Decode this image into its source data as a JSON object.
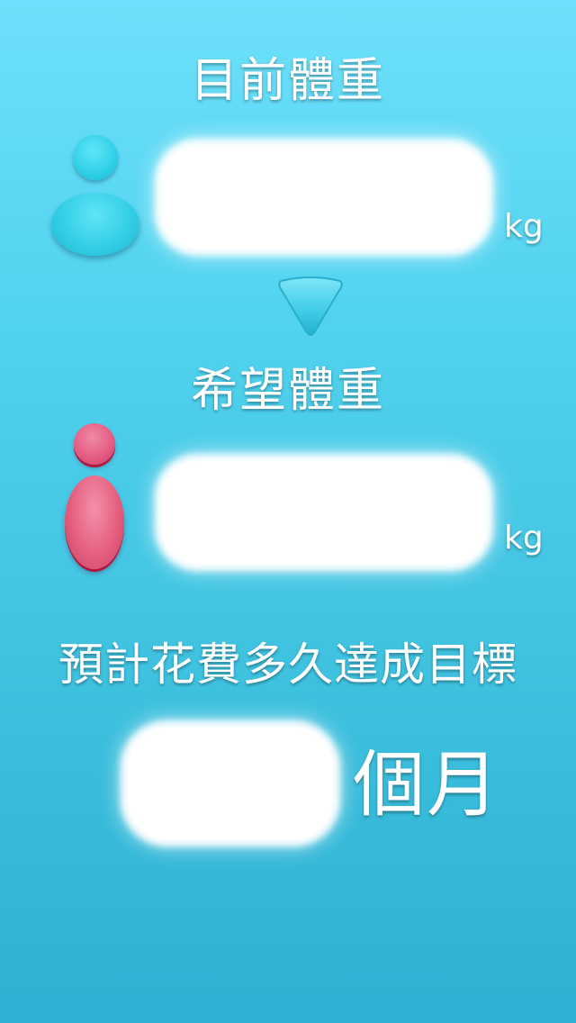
{
  "sections": {
    "current_weight": {
      "title": "目前體重",
      "input_value": "",
      "unit": "kg"
    },
    "target_weight": {
      "title": "希望體重",
      "input_value": "",
      "unit": "kg"
    },
    "duration": {
      "title": "預計花費多久達成目標",
      "input_value": "",
      "unit": "個月"
    }
  },
  "icons": {
    "current_person": "person-icon-blue",
    "target_person": "person-icon-pink",
    "arrow": "arrow-down-icon"
  },
  "colors": {
    "background_top": "#6ee0fb",
    "background_bottom": "#2db0d3",
    "current_person": "#34cfe7",
    "target_person": "#e5607f",
    "text": "#ffffff",
    "field": "#ffffff"
  }
}
